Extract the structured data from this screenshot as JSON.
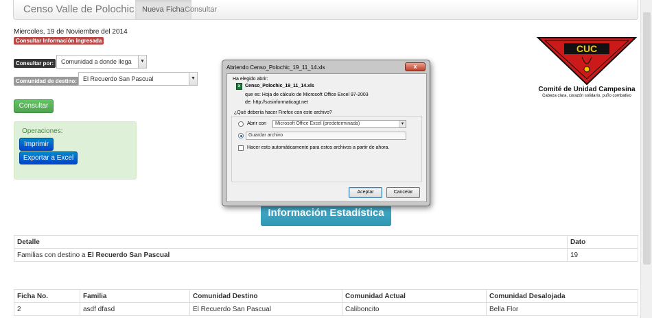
{
  "navbar": {
    "brand": "Censo Valle de Polochic",
    "tabs": [
      {
        "label": "Nueva Ficha",
        "active": true
      },
      {
        "label": "Consultar",
        "active": false
      }
    ]
  },
  "date": "Miercoles, 19 de Noviembre del 2014",
  "consult_badge": "Consultar Información Ingresada",
  "consultar_por": {
    "label": "Consultar por:",
    "selected": "Comunidad a donde llega"
  },
  "comunidad_destino": {
    "label": "Comunidad de destino:",
    "selected": "El Recuerdo San Pascual"
  },
  "consultar_button": "Consultar",
  "operaciones": {
    "title": "Operaciones:",
    "imprimir": "Imprimir",
    "exportar": "Exportar a Excel"
  },
  "logo": {
    "text": "CUC",
    "title": "Comité de Unidad Campesina",
    "subtitle": "Cabeza clara, corazón solidario, puño combativo",
    "colors": {
      "red": "#cc1a1a",
      "yellow": "#f5c400",
      "black": "#111111"
    }
  },
  "stats_button": "Información Estadística",
  "detalle_table": {
    "headers": [
      "Detalle",
      "Dato"
    ],
    "row": {
      "prefix": "Familias con destino a ",
      "bold": "El Recuerdo San Pascual",
      "value": "19"
    }
  },
  "fichas_table": {
    "headers": [
      "Ficha No.",
      "Familia",
      "Comunidad Destino",
      "Comunidad Actual",
      "Comunidad Desalojada"
    ],
    "rows": [
      [
        "2",
        "asdf dfasd",
        "El Recuerdo San Pascual",
        "Caliboncito",
        "Bella Flor"
      ]
    ]
  },
  "dialog": {
    "title": "Abriendo Censo_Polochic_19_11_14.xls",
    "close": "x",
    "chosen_label": "Ha elegido abrir:",
    "file_name": "Censo_Polochic_19_11_14.xls",
    "type_line": "que es:  Hoja de cálculo de Microsoft Office Excel 97-2003",
    "from_line": "de:  http://sosinformaticagt.net",
    "question": "¿Qué debería hacer Firefox con este archivo?",
    "open_with_label": "Abrir con",
    "open_with_app": "Microsoft Office Excel (predeterminada)",
    "save_label": "Guardar archivo",
    "auto_label": "Hacer esto automáticamente para estos archivos a partir de ahora.",
    "accept": "Aceptar",
    "cancel": "Cancelar"
  }
}
